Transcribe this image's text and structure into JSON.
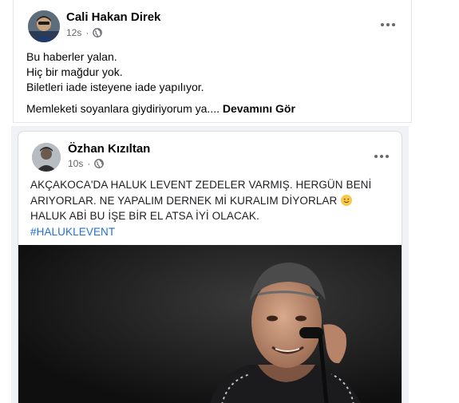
{
  "post1": {
    "author": "Cali Hakan Direk",
    "time": "12s",
    "lines": [
      "Bu haberler yalan.",
      "Hiç bir mağdur yok.",
      "Biletleri iade isteyene iade yapılıyor."
    ],
    "last_line": "Memleketi soyanlara giydiriyorum ya....",
    "see_more": "Devamını Gör"
  },
  "post2": {
    "author": "Özhan Kızıltan",
    "time": "10s",
    "text_part1": "AKÇAKOCA'DA HALUK LEVENT ZEDELER VARMIŞ. HERGÜN BENİ ARIYORLAR. NE YAPALIM DERNEK Mİ KURALIM DİYORLAR",
    "text_part2": "HALUK ABİ BU İŞE BİR EL ATSA İYİ OLACAK.",
    "hashtag": "#HALUKLEVENT"
  },
  "icons": {
    "privacy": "globe-icon",
    "options": "more-options-icon",
    "emoji": "smiling-face-emoji"
  },
  "colors": {
    "link": "#216fdb",
    "secondary_text": "#65676b",
    "primary_button": "#1877f2"
  }
}
